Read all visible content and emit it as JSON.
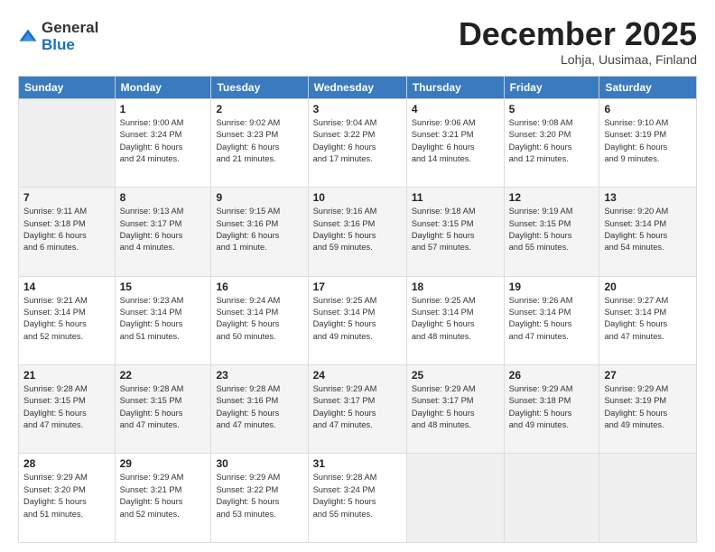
{
  "header": {
    "logo": {
      "general": "General",
      "blue": "Blue"
    },
    "title": "December 2025",
    "location": "Lohja, Uusimaa, Finland"
  },
  "weekdays": [
    "Sunday",
    "Monday",
    "Tuesday",
    "Wednesday",
    "Thursday",
    "Friday",
    "Saturday"
  ],
  "weeks": [
    [
      {
        "day": "",
        "info": ""
      },
      {
        "day": "1",
        "info": "Sunrise: 9:00 AM\nSunset: 3:24 PM\nDaylight: 6 hours\nand 24 minutes."
      },
      {
        "day": "2",
        "info": "Sunrise: 9:02 AM\nSunset: 3:23 PM\nDaylight: 6 hours\nand 21 minutes."
      },
      {
        "day": "3",
        "info": "Sunrise: 9:04 AM\nSunset: 3:22 PM\nDaylight: 6 hours\nand 17 minutes."
      },
      {
        "day": "4",
        "info": "Sunrise: 9:06 AM\nSunset: 3:21 PM\nDaylight: 6 hours\nand 14 minutes."
      },
      {
        "day": "5",
        "info": "Sunrise: 9:08 AM\nSunset: 3:20 PM\nDaylight: 6 hours\nand 12 minutes."
      },
      {
        "day": "6",
        "info": "Sunrise: 9:10 AM\nSunset: 3:19 PM\nDaylight: 6 hours\nand 9 minutes."
      }
    ],
    [
      {
        "day": "7",
        "info": "Sunrise: 9:11 AM\nSunset: 3:18 PM\nDaylight: 6 hours\nand 6 minutes."
      },
      {
        "day": "8",
        "info": "Sunrise: 9:13 AM\nSunset: 3:17 PM\nDaylight: 6 hours\nand 4 minutes."
      },
      {
        "day": "9",
        "info": "Sunrise: 9:15 AM\nSunset: 3:16 PM\nDaylight: 6 hours\nand 1 minute."
      },
      {
        "day": "10",
        "info": "Sunrise: 9:16 AM\nSunset: 3:16 PM\nDaylight: 5 hours\nand 59 minutes."
      },
      {
        "day": "11",
        "info": "Sunrise: 9:18 AM\nSunset: 3:15 PM\nDaylight: 5 hours\nand 57 minutes."
      },
      {
        "day": "12",
        "info": "Sunrise: 9:19 AM\nSunset: 3:15 PM\nDaylight: 5 hours\nand 55 minutes."
      },
      {
        "day": "13",
        "info": "Sunrise: 9:20 AM\nSunset: 3:14 PM\nDaylight: 5 hours\nand 54 minutes."
      }
    ],
    [
      {
        "day": "14",
        "info": "Sunrise: 9:21 AM\nSunset: 3:14 PM\nDaylight: 5 hours\nand 52 minutes."
      },
      {
        "day": "15",
        "info": "Sunrise: 9:23 AM\nSunset: 3:14 PM\nDaylight: 5 hours\nand 51 minutes."
      },
      {
        "day": "16",
        "info": "Sunrise: 9:24 AM\nSunset: 3:14 PM\nDaylight: 5 hours\nand 50 minutes."
      },
      {
        "day": "17",
        "info": "Sunrise: 9:25 AM\nSunset: 3:14 PM\nDaylight: 5 hours\nand 49 minutes."
      },
      {
        "day": "18",
        "info": "Sunrise: 9:25 AM\nSunset: 3:14 PM\nDaylight: 5 hours\nand 48 minutes."
      },
      {
        "day": "19",
        "info": "Sunrise: 9:26 AM\nSunset: 3:14 PM\nDaylight: 5 hours\nand 47 minutes."
      },
      {
        "day": "20",
        "info": "Sunrise: 9:27 AM\nSunset: 3:14 PM\nDaylight: 5 hours\nand 47 minutes."
      }
    ],
    [
      {
        "day": "21",
        "info": "Sunrise: 9:28 AM\nSunset: 3:15 PM\nDaylight: 5 hours\nand 47 minutes."
      },
      {
        "day": "22",
        "info": "Sunrise: 9:28 AM\nSunset: 3:15 PM\nDaylight: 5 hours\nand 47 minutes."
      },
      {
        "day": "23",
        "info": "Sunrise: 9:28 AM\nSunset: 3:16 PM\nDaylight: 5 hours\nand 47 minutes."
      },
      {
        "day": "24",
        "info": "Sunrise: 9:29 AM\nSunset: 3:17 PM\nDaylight: 5 hours\nand 47 minutes."
      },
      {
        "day": "25",
        "info": "Sunrise: 9:29 AM\nSunset: 3:17 PM\nDaylight: 5 hours\nand 48 minutes."
      },
      {
        "day": "26",
        "info": "Sunrise: 9:29 AM\nSunset: 3:18 PM\nDaylight: 5 hours\nand 49 minutes."
      },
      {
        "day": "27",
        "info": "Sunrise: 9:29 AM\nSunset: 3:19 PM\nDaylight: 5 hours\nand 49 minutes."
      }
    ],
    [
      {
        "day": "28",
        "info": "Sunrise: 9:29 AM\nSunset: 3:20 PM\nDaylight: 5 hours\nand 51 minutes."
      },
      {
        "day": "29",
        "info": "Sunrise: 9:29 AM\nSunset: 3:21 PM\nDaylight: 5 hours\nand 52 minutes."
      },
      {
        "day": "30",
        "info": "Sunrise: 9:29 AM\nSunset: 3:22 PM\nDaylight: 5 hours\nand 53 minutes."
      },
      {
        "day": "31",
        "info": "Sunrise: 9:28 AM\nSunset: 3:24 PM\nDaylight: 5 hours\nand 55 minutes."
      },
      {
        "day": "",
        "info": ""
      },
      {
        "day": "",
        "info": ""
      },
      {
        "day": "",
        "info": ""
      }
    ]
  ]
}
